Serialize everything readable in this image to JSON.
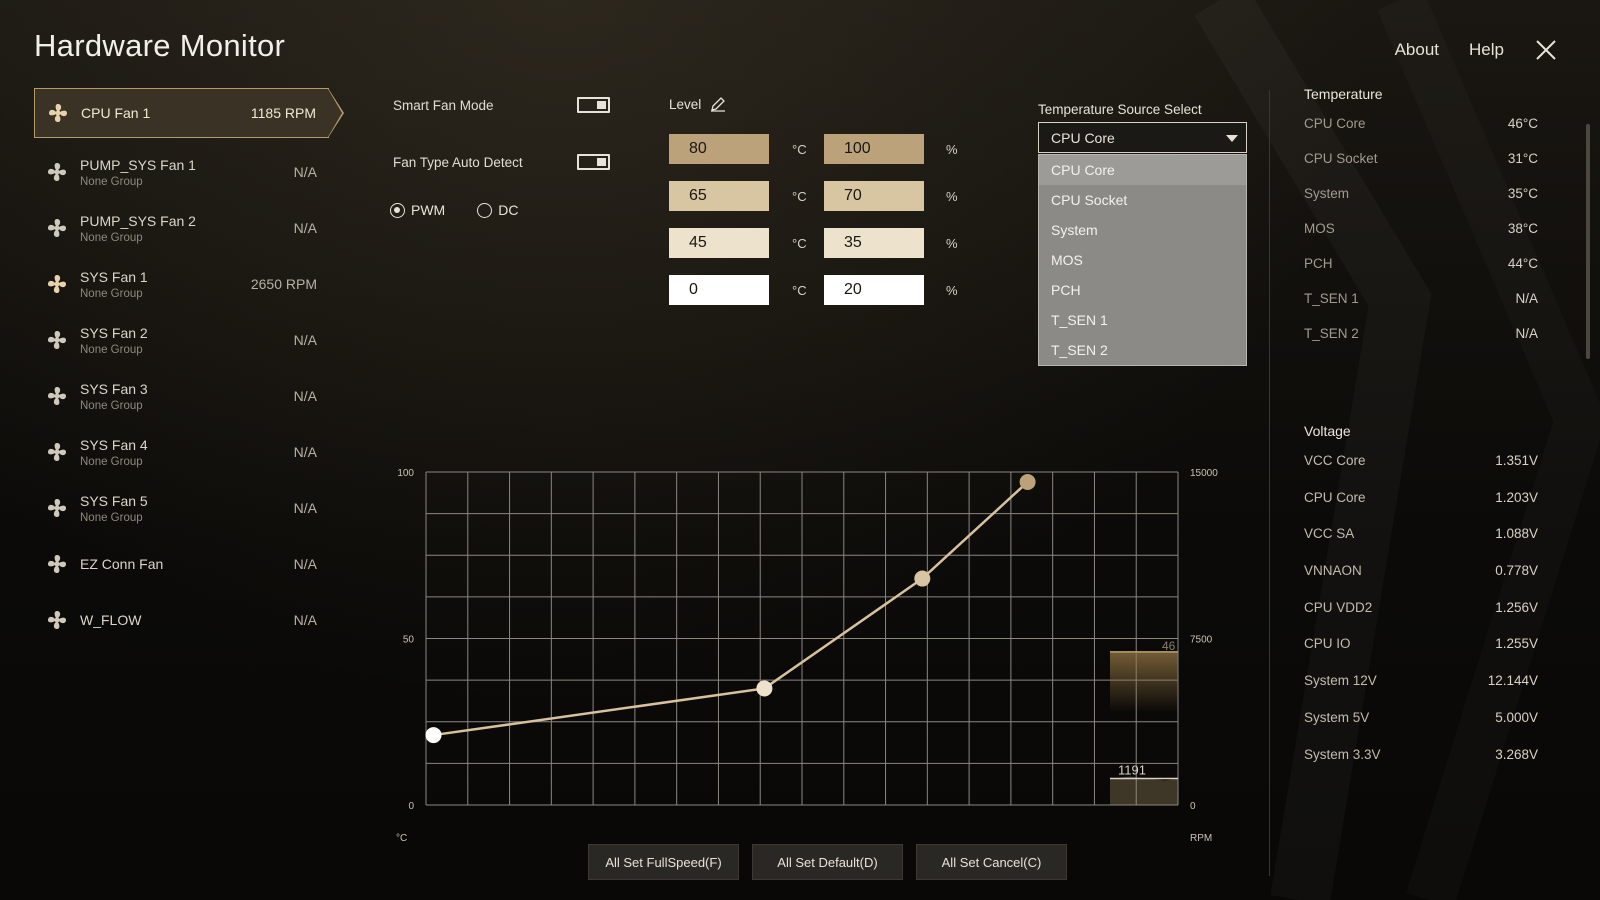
{
  "app": {
    "title": "Hardware Monitor"
  },
  "nav": {
    "about": "About",
    "help": "Help"
  },
  "fans": [
    {
      "name": "CPU Fan 1",
      "group": "",
      "speed": "1185 RPM",
      "active": true
    },
    {
      "name": "PUMP_SYS Fan 1",
      "group": "None Group",
      "speed": "N/A"
    },
    {
      "name": "PUMP_SYS Fan 2",
      "group": "None Group",
      "speed": "N/A"
    },
    {
      "name": "SYS Fan 1",
      "group": "None Group",
      "speed": "2650 RPM"
    },
    {
      "name": "SYS Fan 2",
      "group": "None Group",
      "speed": "N/A"
    },
    {
      "name": "SYS Fan 3",
      "group": "None Group",
      "speed": "N/A"
    },
    {
      "name": "SYS Fan 4",
      "group": "None Group",
      "speed": "N/A"
    },
    {
      "name": "SYS Fan 5",
      "group": "None Group",
      "speed": "N/A"
    },
    {
      "name": "EZ Conn Fan",
      "group": "",
      "speed": "N/A"
    },
    {
      "name": "W_FLOW",
      "group": "",
      "speed": "N/A"
    }
  ],
  "controls": {
    "smart_fan_mode": "Smart Fan Mode",
    "fan_type_auto_detect": "Fan Type Auto Detect",
    "pwm": "PWM",
    "dc": "DC",
    "level": "Level"
  },
  "levels": [
    {
      "temp": "80",
      "pct": "100",
      "temp_unit": "°C",
      "pct_unit": "%",
      "color": "#bca27a"
    },
    {
      "temp": "65",
      "pct": "70",
      "temp_unit": "°C",
      "pct_unit": "%",
      "color": "#d8c5a2"
    },
    {
      "temp": "45",
      "pct": "35",
      "temp_unit": "°C",
      "pct_unit": "%",
      "color": "#ede2cc"
    },
    {
      "temp": "0",
      "pct": "20",
      "temp_unit": "°C",
      "pct_unit": "%",
      "color": "#ffffff"
    }
  ],
  "temp_source": {
    "label": "Temperature Source Select",
    "selected": "CPU Core",
    "options": [
      "CPU Core",
      "CPU Socket",
      "System",
      "MOS",
      "PCH",
      "T_SEN 1",
      "T_SEN 2"
    ]
  },
  "temperature": {
    "title": "Temperature",
    "items": [
      {
        "name": "CPU Core",
        "value": "46°C"
      },
      {
        "name": "CPU Socket",
        "value": "31°C"
      },
      {
        "name": "System",
        "value": "35°C"
      },
      {
        "name": "MOS",
        "value": "38°C"
      },
      {
        "name": "PCH",
        "value": "44°C"
      },
      {
        "name": "T_SEN 1",
        "value": "N/A"
      },
      {
        "name": "T_SEN 2",
        "value": "N/A"
      }
    ]
  },
  "voltage": {
    "title": "Voltage",
    "items": [
      {
        "name": "VCC Core",
        "value": "1.351V"
      },
      {
        "name": "CPU Core",
        "value": "1.203V"
      },
      {
        "name": "VCC SA",
        "value": "1.088V"
      },
      {
        "name": "VNNAON",
        "value": "0.778V"
      },
      {
        "name": "CPU VDD2",
        "value": "1.256V"
      },
      {
        "name": "CPU IO",
        "value": "1.255V"
      },
      {
        "name": "System 12V",
        "value": "12.144V"
      },
      {
        "name": "System 5V",
        "value": "5.000V"
      },
      {
        "name": "System 3.3V",
        "value": "3.268V"
      }
    ]
  },
  "buttons": {
    "full_speed": "All Set FullSpeed(F)",
    "default": "All Set Default(D)",
    "cancel": "All Set Cancel(C)"
  },
  "chart_data": {
    "type": "line",
    "left_axis": {
      "ticks": [
        "100",
        "50",
        "0"
      ],
      "unit": "°C",
      "range": [
        0,
        100
      ]
    },
    "right_axis": {
      "ticks": [
        "15000",
        "7500",
        "0"
      ],
      "unit": "RPM",
      "range": [
        0,
        15000
      ]
    },
    "x_range": [
      0,
      100
    ],
    "series": [
      {
        "points": [
          [
            1,
            21
          ],
          [
            45,
            35
          ],
          [
            66,
            68
          ],
          [
            80,
            97
          ]
        ]
      }
    ],
    "live_temp": {
      "label": "46",
      "value": 46
    },
    "live_rpm": {
      "label": "1191",
      "value": 1191
    },
    "grid": true,
    "line_color": "#d7c2a0",
    "grid_color": "#8a8780"
  }
}
